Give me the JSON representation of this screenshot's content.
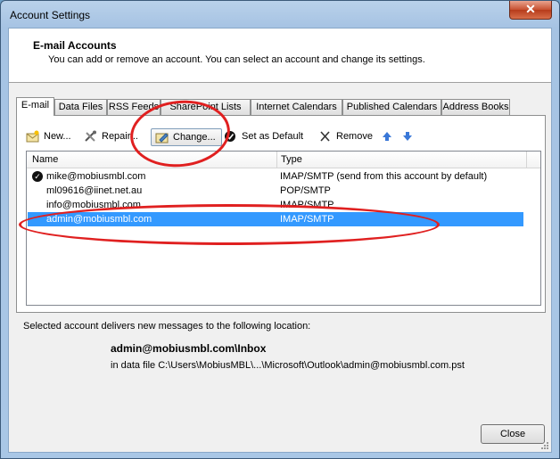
{
  "window": {
    "title": "Account Settings",
    "close_glyph": "✕"
  },
  "header": {
    "title": "E-mail Accounts",
    "subtitle": "You can add or remove an account. You can select an account and change its settings."
  },
  "tabs": [
    {
      "label": "E-mail",
      "active": true
    },
    {
      "label": "Data Files"
    },
    {
      "label": "RSS Feeds"
    },
    {
      "label": "SharePoint Lists"
    },
    {
      "label": "Internet Calendars"
    },
    {
      "label": "Published Calendars"
    },
    {
      "label": "Address Books"
    }
  ],
  "toolbar": {
    "new_label": "New...",
    "repair_label": "Repair...",
    "change_label": "Change...",
    "set_default_label": "Set as Default",
    "remove_label": "Remove"
  },
  "list": {
    "columns": {
      "name": "Name",
      "type": "Type"
    },
    "rows": [
      {
        "name": "mike@mobiusmbl.com",
        "type": "IMAP/SMTP (send from this account by default)",
        "default": true
      },
      {
        "name": "ml09616@iinet.net.au",
        "type": "POP/SMTP"
      },
      {
        "name": "info@mobiusmbl.com",
        "type": "IMAP/SMTP"
      },
      {
        "name": "admin@mobiusmbl.com",
        "type": "IMAP/SMTP",
        "selected": true
      }
    ]
  },
  "delivery": {
    "text": "Selected account delivers new messages to the following location:",
    "location": "admin@mobiusmbl.com\\Inbox",
    "data_file": "in data file C:\\Users\\MobiusMBL\\...\\Microsoft\\Outlook\\admin@mobiusmbl.com.pst"
  },
  "footer": {
    "close_label": "Close"
  },
  "colors": {
    "selection": "#3399ff",
    "annotation": "#e02020",
    "close_button": "#c75030"
  }
}
